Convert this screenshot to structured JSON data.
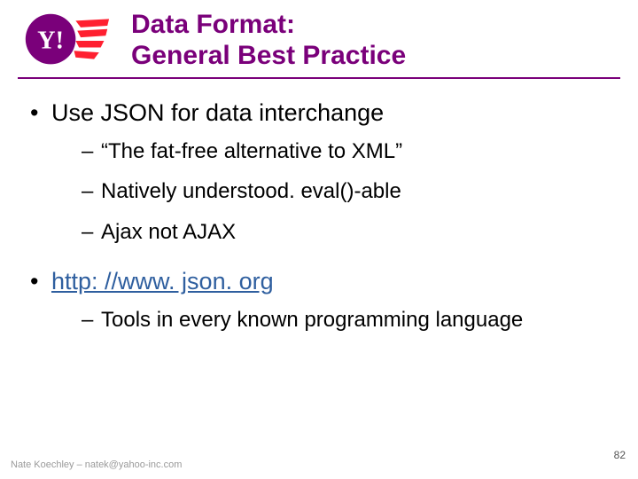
{
  "header": {
    "title_line1": "Data Format:",
    "title_line2": "General Best Practice",
    "logo_name": "yahoo-logo"
  },
  "bullets": [
    {
      "text": "Use JSON for data interchange",
      "link": false,
      "sub": [
        "“The fat-free alternative to XML”",
        "Natively understood. eval()-able",
        "Ajax not AJAX"
      ]
    },
    {
      "text": "http: //www. json. org",
      "link": true,
      "sub": [
        "Tools in every known programming language"
      ]
    }
  ],
  "footer": {
    "author": "Nate Koechley – natek@yahoo-inc.com",
    "page": "82"
  }
}
